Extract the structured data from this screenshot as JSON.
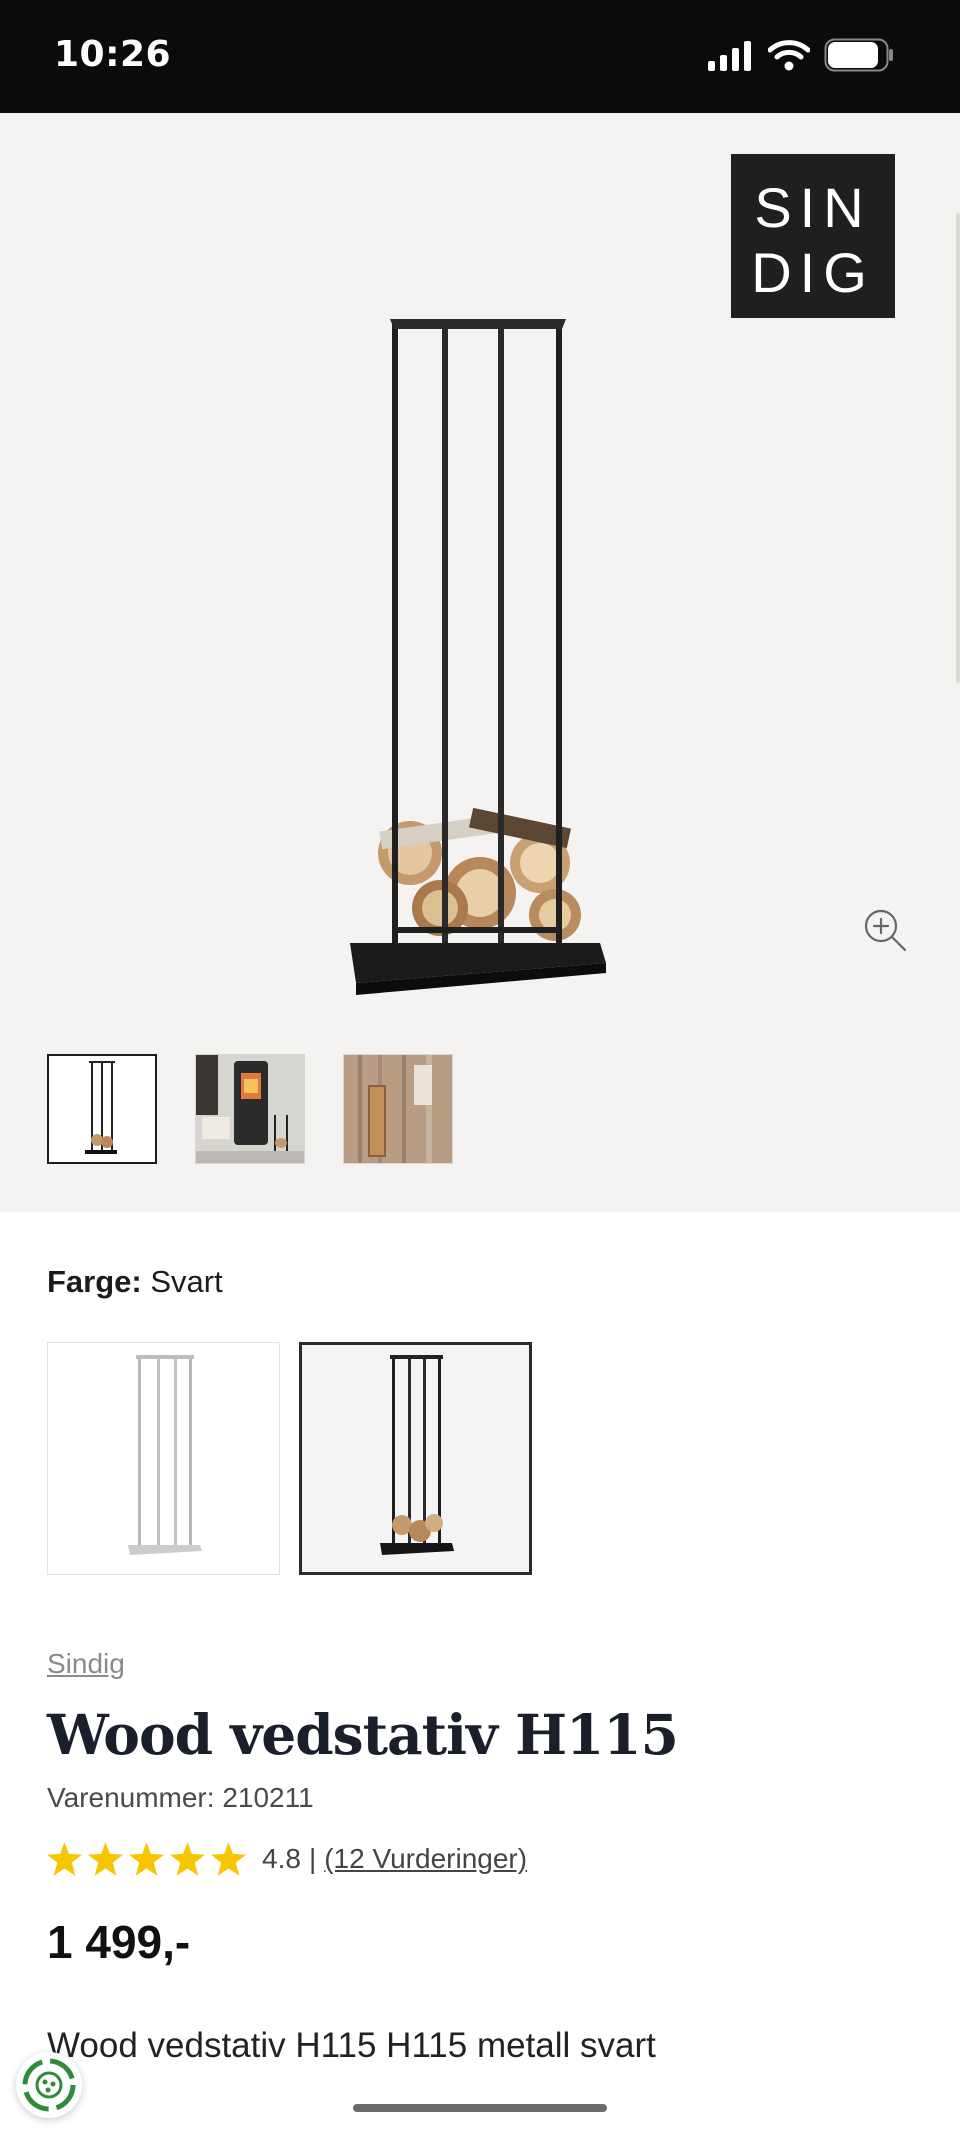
{
  "status_bar": {
    "time": "10:26"
  },
  "gallery": {
    "brand_logo": [
      "SIN",
      "DIG"
    ],
    "zoom_icon": "zoom-in-icon",
    "thumbnails": [
      "rack-studio",
      "rack-fireplace",
      "rack-wall"
    ]
  },
  "options": {
    "color_label": "Farge:",
    "color_value": "Svart",
    "swatches": [
      {
        "name": "light-grey",
        "selected": false
      },
      {
        "name": "black",
        "selected": true
      }
    ]
  },
  "product": {
    "brand": "Sindig",
    "title": "Wood vedstativ H115",
    "sku": "Varenummer: 210211",
    "rating_value": "4.8",
    "rating_separator": "|",
    "rating_count": "(12 Vurderinger)",
    "rating": 4.8,
    "price": "1 499,-",
    "description": "Wood vedstativ H115 H115 metall svart"
  },
  "colors": {
    "star": "#f7c600",
    "dark": "#1c1c1c",
    "gallery_bg": "#f4f3f1"
  }
}
